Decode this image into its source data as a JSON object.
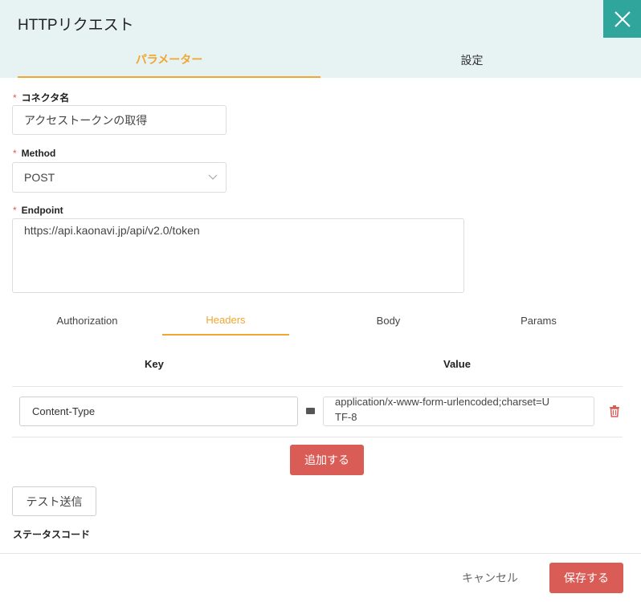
{
  "dialog": {
    "title": "HTTPリクエスト"
  },
  "top_tabs": [
    {
      "label": "パラメーター",
      "active": true
    },
    {
      "label": "設定",
      "active": false
    }
  ],
  "fields": {
    "connector_name": {
      "label": "コネクタ名",
      "value": "アクセストークンの取得",
      "required": true
    },
    "method": {
      "label": "Method",
      "value": "POST",
      "required": true
    },
    "endpoint": {
      "label": "Endpoint",
      "value": "https://api.kaonavi.jp/api/v2.0/token",
      "required": true
    }
  },
  "sub_tabs": [
    {
      "label": "Authorization",
      "active": false
    },
    {
      "label": "Headers",
      "active": true
    },
    {
      "label": "Body",
      "active": false
    },
    {
      "label": "Params",
      "active": false
    }
  ],
  "headers_table": {
    "columns": [
      "Key",
      "Value"
    ],
    "rows": [
      {
        "key": "Content-Type",
        "value_line1": "application/x-www-form-urlencoded;charset=U",
        "value_line2": "TF-8"
      }
    ]
  },
  "buttons": {
    "add": "追加する",
    "test_send": "テスト送信",
    "cancel": "キャンセル",
    "save": "保存する"
  },
  "status_code_label": "ステータスコード",
  "icons": {
    "close": "close-icon",
    "dropdown": "chevron-down-icon",
    "delete": "trash-icon"
  },
  "colors": {
    "accent": "#f0a630",
    "teal": "#2fa59c",
    "danger": "#d95d56",
    "header_bg": "#e6f3f2"
  }
}
